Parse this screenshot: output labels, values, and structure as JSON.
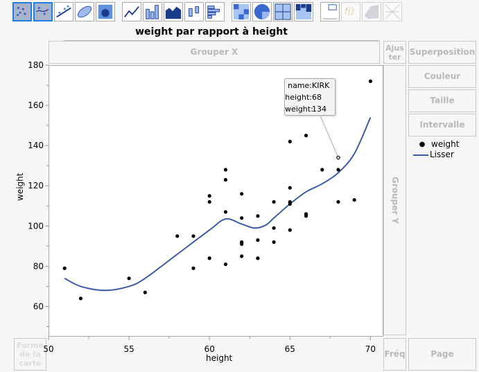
{
  "toolbar": {
    "icons": [
      "points-icon",
      "smoother-icon",
      "line-of-fit-icon",
      "ellipse-icon",
      "contour-icon",
      "line-icon",
      "bar-icon",
      "area-icon",
      "box-plot-icon",
      "histogram-icon",
      "heatmap-icon",
      "pie-icon",
      "treemap-icon",
      "mosaic-icon",
      "caption-box-icon",
      "formula-icon",
      "map-shape-icon",
      "parallel-icon"
    ],
    "selected": [
      "points-icon",
      "smoother-icon"
    ]
  },
  "title": "weight par rapport à height",
  "zones": {
    "group_x": "Grouper X",
    "group_y": "Grouper Y",
    "fit": "Ajuster",
    "overlay": "Superposition",
    "color": "Couleur",
    "size": "Taille",
    "interval": "Intervalle",
    "map_shape": "Forme de la carte",
    "freq": "Fréq",
    "page": "Page"
  },
  "legend": {
    "points": "weight",
    "smoother": "Lisser"
  },
  "tooltip": {
    "rows": [
      {
        "k": "name:",
        "v": "KIRK"
      },
      {
        "k": "height:",
        "v": "68"
      },
      {
        "k": "weight:",
        "v": "134"
      }
    ]
  },
  "colors": {
    "smoother": "#3a5ba8",
    "points": "#000000",
    "selected": "#1e7fe0"
  },
  "chart_data": {
    "type": "scatter",
    "xlabel": "height",
    "ylabel": "weight",
    "xlim": [
      50,
      70.8
    ],
    "ylim": [
      45,
      180
    ],
    "xticks": [
      50,
      55,
      60,
      65,
      70
    ],
    "yticks": [
      60,
      80,
      100,
      120,
      140,
      160,
      180
    ],
    "points": [
      [
        51,
        79
      ],
      [
        52,
        64
      ],
      [
        55,
        74
      ],
      [
        56,
        67
      ],
      [
        58,
        95
      ],
      [
        59,
        95
      ],
      [
        59,
        79
      ],
      [
        60,
        115
      ],
      [
        60,
        112
      ],
      [
        60,
        84
      ],
      [
        61,
        128
      ],
      [
        61,
        123
      ],
      [
        61,
        107
      ],
      [
        61,
        81
      ],
      [
        62,
        116
      ],
      [
        62,
        104
      ],
      [
        62,
        92
      ],
      [
        62,
        91
      ],
      [
        62,
        85
      ],
      [
        63,
        105
      ],
      [
        63,
        93
      ],
      [
        63,
        84
      ],
      [
        64,
        112
      ],
      [
        64,
        99
      ],
      [
        64,
        92
      ],
      [
        65,
        142
      ],
      [
        65,
        119
      ],
      [
        65,
        112
      ],
      [
        65,
        111
      ],
      [
        65,
        98
      ],
      [
        66,
        145
      ],
      [
        66,
        106
      ],
      [
        66,
        105
      ],
      [
        67,
        128
      ],
      [
        68,
        134
      ],
      [
        68,
        128
      ],
      [
        68,
        112
      ],
      [
        69,
        113
      ],
      [
        70,
        172
      ]
    ],
    "smoother": [
      [
        51,
        74
      ],
      [
        52,
        70
      ],
      [
        53.5,
        68
      ],
      [
        55,
        70
      ],
      [
        56,
        74
      ],
      [
        58,
        86
      ],
      [
        60,
        98
      ],
      [
        61,
        103.5
      ],
      [
        62,
        101
      ],
      [
        62.8,
        99
      ],
      [
        63.5,
        100.5
      ],
      [
        64,
        104
      ],
      [
        65,
        111
      ],
      [
        66,
        117
      ],
      [
        67,
        121
      ],
      [
        68,
        126.5
      ],
      [
        69,
        136
      ],
      [
        70,
        154
      ]
    ],
    "highlighted": [
      68,
      134
    ]
  }
}
